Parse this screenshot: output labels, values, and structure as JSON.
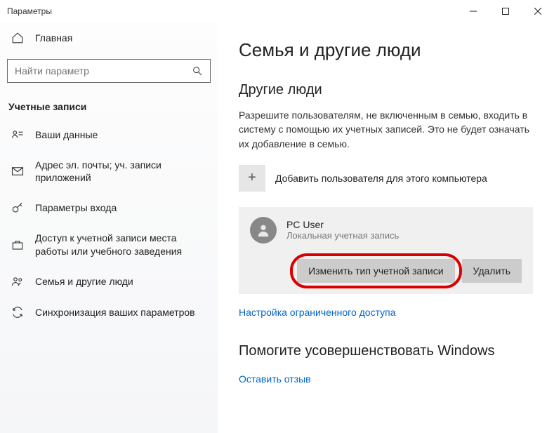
{
  "window": {
    "title": "Параметры"
  },
  "sidebar": {
    "home": "Главная",
    "search_placeholder": "Найти параметр",
    "section": "Учетные записи",
    "items": [
      {
        "label": "Ваши данные"
      },
      {
        "label": "Адрес эл. почты; уч. записи приложений"
      },
      {
        "label": "Параметры входа"
      },
      {
        "label": "Доступ к учетной записи места работы или учебного заведения"
      },
      {
        "label": "Семья и другие люди"
      },
      {
        "label": "Синхронизация ваших параметров"
      }
    ]
  },
  "main": {
    "title": "Семья и другие люди",
    "other_people_heading": "Другие люди",
    "other_people_desc": "Разрешите пользователям, не включенным в семью, входить в систему с помощью их учетных записей. Это не будет означать их добавление в семью.",
    "add_user_label": "Добавить пользователя для этого компьютера",
    "user": {
      "name": "PC User",
      "type": "Локальная учетная запись",
      "change_type_btn": "Изменить тип учетной записи",
      "delete_btn": "Удалить"
    },
    "restricted_link": "Настройка ограниченного доступа",
    "help_heading": "Помогите усовершенствовать Windows",
    "help_link": "Оставить отзыв"
  }
}
